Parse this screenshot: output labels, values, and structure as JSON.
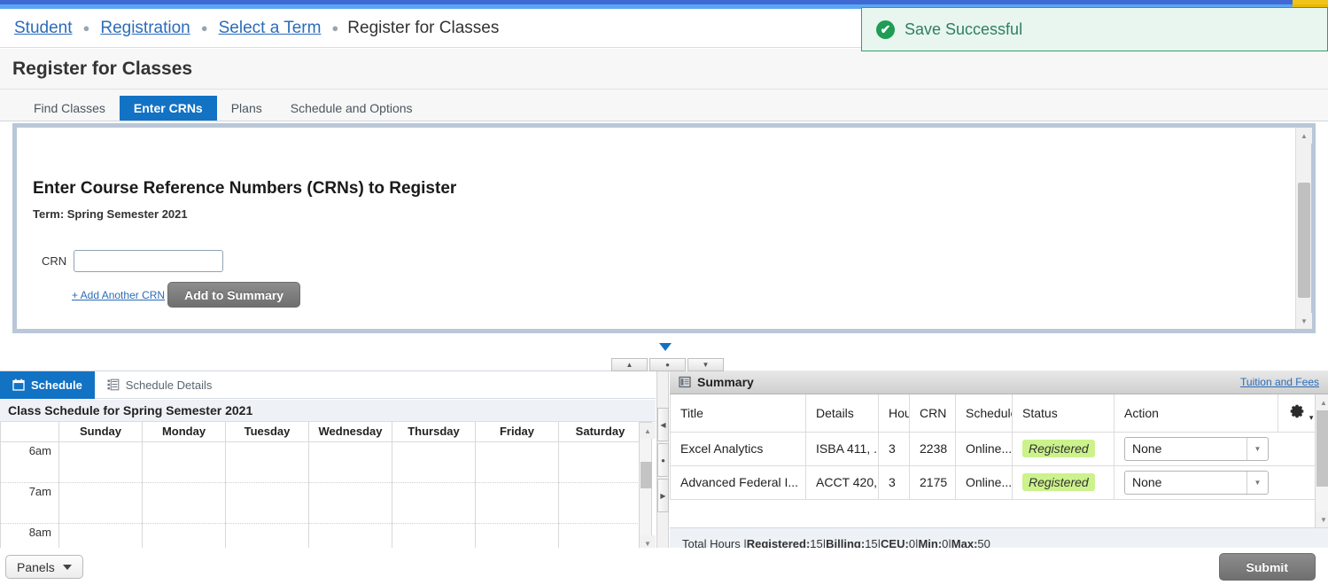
{
  "theme": {
    "accent_blue": "#1272c4",
    "stripe_blue": "#4169d4",
    "stripe_light_blue": "#5aa7f0",
    "stripe_gold": "#f0c419",
    "success_green": "#1f9d55",
    "status_badge_green": "#ccf28c",
    "link_blue": "#2b6cb8"
  },
  "breadcrumb": {
    "items": [
      {
        "label": "Student",
        "link": true
      },
      {
        "label": "Registration",
        "link": true
      },
      {
        "label": "Select a Term",
        "link": true
      },
      {
        "label": "Register for Classes",
        "link": false
      }
    ],
    "separator": "●"
  },
  "toast": {
    "icon": "check-circle-icon",
    "message": "Save Successful",
    "check_glyph": "✔"
  },
  "page": {
    "title": "Register for Classes"
  },
  "tabs": [
    {
      "label": "Find Classes",
      "active": false
    },
    {
      "label": "Enter CRNs",
      "active": true
    },
    {
      "label": "Plans",
      "active": false
    },
    {
      "label": "Schedule and Options",
      "active": false
    }
  ],
  "crn_panel": {
    "heading": "Enter Course Reference Numbers (CRNs) to Register",
    "term_label": "Term: Spring Semester 2021",
    "crn_label": "CRN",
    "crn_value": "",
    "crn_placeholder": "",
    "add_another_label": "+ Add Another CRN",
    "add_to_summary_label": "Add to Summary",
    "scroll_up_glyph": "▲",
    "scroll_down_glyph": "▼"
  },
  "splitter": {
    "collapse_caret": "caret-down-icon",
    "buttons": [
      {
        "name": "expand-up-button",
        "glyph": "▲"
      },
      {
        "name": "restore-button",
        "glyph": "●"
      },
      {
        "name": "expand-down-button",
        "glyph": "▼"
      }
    ],
    "vertical_buttons": [
      {
        "name": "collapse-left-button",
        "glyph": "◀"
      },
      {
        "name": "restore-vertical-button",
        "glyph": "●"
      },
      {
        "name": "collapse-right-button",
        "glyph": "▶"
      }
    ]
  },
  "schedule_panel": {
    "tabs": [
      {
        "label": "Schedule",
        "icon": "calendar-icon",
        "active": true
      },
      {
        "label": "Schedule Details",
        "icon": "list-detail-icon",
        "active": false
      }
    ],
    "caption": "Class Schedule for Spring Semester 2021",
    "day_headers": [
      "",
      "Sunday",
      "Monday",
      "Tuesday",
      "Wednesday",
      "Thursday",
      "Friday",
      "Saturday"
    ],
    "time_rows": [
      "6am",
      "7am",
      "8am"
    ],
    "scroll_up_glyph": "▲",
    "scroll_down_glyph": "▼"
  },
  "summary_panel": {
    "icon": "summary-table-icon",
    "title": "Summary",
    "tuition_link": "Tuition and Fees",
    "settings_icon": "gear-icon",
    "columns": [
      "Title",
      "Details",
      "Hour",
      "CRN",
      "Schedule",
      "Status",
      "Action",
      ""
    ],
    "rows": [
      {
        "title": "Excel Analytics",
        "details": "ISBA 411, ...",
        "hours": "3",
        "crn": "2238",
        "schedule": "Online...",
        "status": "Registered",
        "action": "None"
      },
      {
        "title": "Advanced Federal I...",
        "details": "ACCT 420,...",
        "hours": "3",
        "crn": "2175",
        "schedule": "Online...",
        "status": "Registered",
        "action": "None"
      }
    ],
    "totals": {
      "prefix": "Total Hours | ",
      "registered_label": "Registered:",
      "registered_value": " 15",
      "billing_label": "Billing:",
      "billing_value": " 15",
      "ceu_label": "CEU:",
      "ceu_value": " 0",
      "min_label": "Min:",
      "min_value": " 0",
      "max_label": "Max:",
      "max_value": " 50",
      "divider": " | "
    },
    "dropdown_arrow": "▼",
    "scroll_up_glyph": "▲",
    "scroll_down_glyph": "▼"
  },
  "bottom_bar": {
    "panels_label": "Panels",
    "submit_label": "Submit"
  }
}
